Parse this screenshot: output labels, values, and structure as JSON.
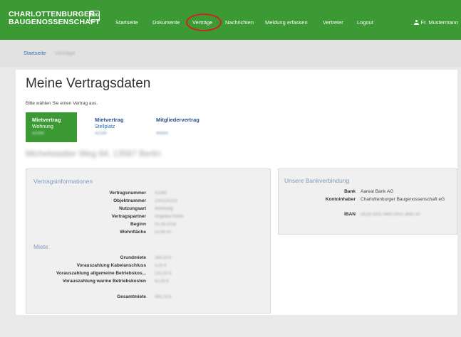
{
  "header": {
    "logo_line1": "CHARLOTTENBURGER",
    "logo_line2": "BAUGENOSSENSCHAFT",
    "logo_mark": "CBG",
    "nav": [
      "Startseite",
      "Dokumente",
      "Verträge",
      "Nachrichten",
      "Meldung erfassen",
      "Vertreter",
      "Logout"
    ],
    "active_nav": "Verträge",
    "user": "Fr. Mustermann"
  },
  "breadcrumb": {
    "home": "Startseite",
    "current": "Verträge"
  },
  "page": {
    "title": "Meine Vertragsdaten",
    "hint": "Bitte wählen Sie einen Vertrag aus."
  },
  "tabs": [
    {
      "title": "Mietvertrag",
      "sub": "Wohnung",
      "number": "41089",
      "active": true
    },
    {
      "title": "Mietvertrag",
      "sub": "Stellplatz",
      "number": "42189",
      "active": false
    },
    {
      "title": "Mitgliedervertrag",
      "sub": "",
      "number": "46484",
      "active": false
    }
  ],
  "address": "Michelstadter Weg 64, 13587 Berlin",
  "contract_info": {
    "heading": "Vertragsinformationen",
    "rows": [
      {
        "label": "Vertragsnummer",
        "value": "41089"
      },
      {
        "label": "Objektnummer",
        "value": "1051141115"
      },
      {
        "label": "Nutzungsart",
        "value": "Wohnung"
      },
      {
        "label": "Vertragspartner",
        "value": "Angelika Krebs"
      },
      {
        "label": "Beginn",
        "value": "01.08.2016"
      },
      {
        "label": "Wohnfläche",
        "value": "53,48 m²"
      }
    ]
  },
  "rent": {
    "heading": "Miete",
    "rows": [
      {
        "label": "Grundmiete",
        "value": "284,33 €"
      },
      {
        "label": "Vorauszahlung Kabelanschluss",
        "value": "3,00 €"
      },
      {
        "label": "Vorauszahlung allgemeine Betriebskos...",
        "value": "131,00 €"
      },
      {
        "label": "Vorauszahlung warme Betriebskosten",
        "value": "62,00 €"
      }
    ],
    "total_label": "Gesamtmiete",
    "total_value": "480,78 €"
  },
  "bank": {
    "heading": "Unsere Bankverbindung",
    "bank_label": "Bank",
    "bank_value": "Aareal Bank AG",
    "holder_label": "Kontoinhaber",
    "holder_value": "Charlottenburger Baugenossenschaft eG",
    "iban_label": "IBAN",
    "iban_value": "DE29 5501 0400 0001 3640 30"
  },
  "colors": {
    "brand_green": "#3c9a35",
    "link_blue": "#2c4f8c",
    "highlight_red": "#d42020"
  }
}
